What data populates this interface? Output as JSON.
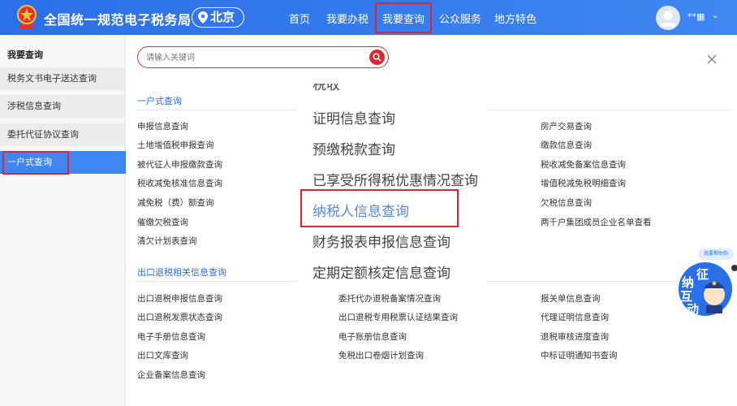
{
  "header": {
    "site_title": "全国统一规范电子税务局",
    "city": "北京",
    "nav": [
      "首页",
      "我要办税",
      "我要查询",
      "公众服务",
      "地方特色"
    ],
    "active_nav": "我要查询",
    "user_name": "**▦"
  },
  "sidebar": {
    "title": "我要查询",
    "items": [
      {
        "label": "税务文书电子送达查询"
      },
      {
        "label": "涉税信息查询"
      },
      {
        "label": "委托代征协议查询"
      },
      {
        "label": "一户式查询"
      }
    ],
    "active_index": 3
  },
  "search": {
    "placeholder": "请输入关键词"
  },
  "sections": [
    {
      "title": "一户式查询",
      "col1": [
        "申报信息查询",
        "土地增值税申报查询",
        "被代征人申报缴款查询",
        "税收减免核准信息查询",
        "减免税（费）额查询",
        "催缴欠税查询",
        "清欠计划表查询"
      ],
      "col3": [
        "房产交易查询",
        "缴款信息查询",
        "税收减免备案信息查询",
        "增值税减免税明细查询",
        "欠税信息查询",
        "两千户集团成员企业名单查看"
      ]
    },
    {
      "title": "出口退税相关信息查询",
      "col1": [
        "出口退税申报信息查询",
        "出口退税发票状态查询",
        "电子手册信息查询",
        "出口文库查询",
        "企业备案信息查询"
      ],
      "col2": [
        "委托代办退税备案情况查询",
        "出口退税专用税票认证结果查询",
        "电子账册信息查询",
        "免税出口卷烟计划查询"
      ],
      "col3": [
        "报关单信息查询",
        "代理证明信息查询",
        "退税审核进度查询",
        "中标证明通知书查询"
      ]
    }
  ],
  "zoom": {
    "clipped": "税收                             ",
    "items": [
      "证明信息查询",
      "预缴税款查询",
      "已享受所得税优惠情况查询",
      "纳税人信息查询",
      "财务报表申报信息查询",
      "定期定额核定信息查询"
    ],
    "highlighted": "纳税人信息查询"
  },
  "float_widget": {
    "bubble": "我要帮助你",
    "chars": [
      "征",
      "纳",
      "互",
      "动"
    ]
  },
  "colors": {
    "brand_blue": "#3f86f2",
    "highlight_red": "#d9272e",
    "section_blue": "#2a6fe6"
  }
}
